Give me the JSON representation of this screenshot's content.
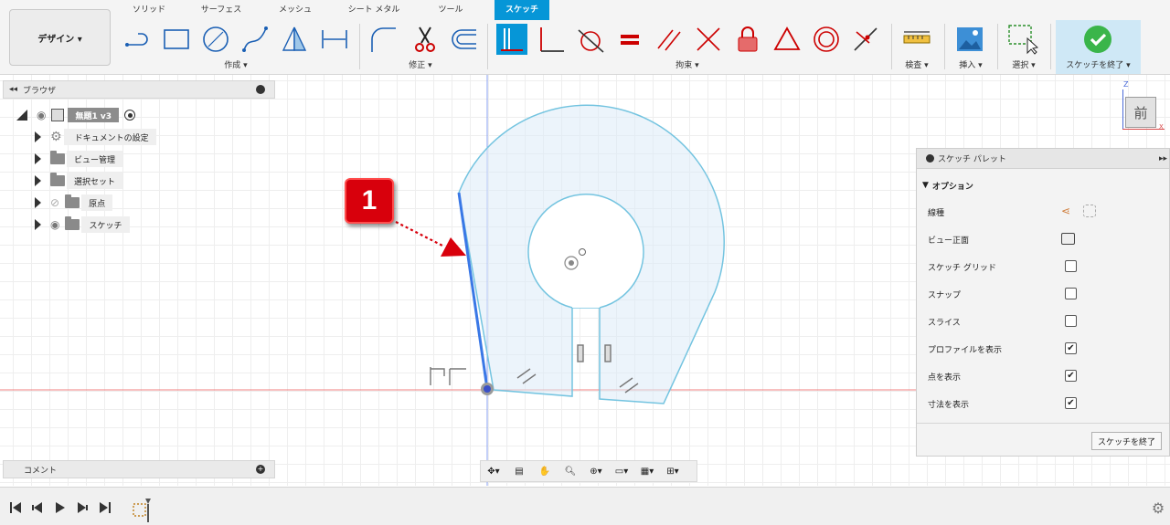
{
  "design_button": "デザイン ▾",
  "workspace_tabs": [
    "ソリッド",
    "サーフェス",
    "メッシュ",
    "シート メタル",
    "ツール",
    "スケッチ"
  ],
  "groups": {
    "create": "作成 ▾",
    "modify": "修正 ▾",
    "constrain": "拘束 ▾",
    "inspect": "検査 ▾",
    "insert": "挿入 ▾",
    "select": "選択 ▾",
    "finish": "スケッチを終了 ▾"
  },
  "browser": {
    "title": "ブラウザ",
    "root": "無題1 v3",
    "items": [
      "ドキュメントの設定",
      "ビュー管理",
      "選択セット",
      "原点",
      "スケッチ"
    ]
  },
  "palette": {
    "title": "スケッチ パレット",
    "section": "オプション",
    "rows": [
      {
        "label": "線種",
        "type": "icon"
      },
      {
        "label": "ビュー正面",
        "type": "icon"
      },
      {
        "label": "スケッチ グリッド",
        "checked": false
      },
      {
        "label": "スナップ",
        "checked": false
      },
      {
        "label": "スライス",
        "checked": false
      },
      {
        "label": "プロファイルを表示",
        "checked": true
      },
      {
        "label": "点を表示",
        "checked": true
      },
      {
        "label": "寸法を表示",
        "checked": true
      }
    ],
    "finish_button": "スケッチを終了"
  },
  "comment": "コメント",
  "viewcube": {
    "face": "前",
    "axis_z": "Z",
    "axis_x": "X"
  },
  "callout": "1",
  "colors": {
    "accent": "#0696d7",
    "callout": "#d8000c",
    "sketch_line": "#74c4e0",
    "selected_line": "#3a78e6"
  }
}
